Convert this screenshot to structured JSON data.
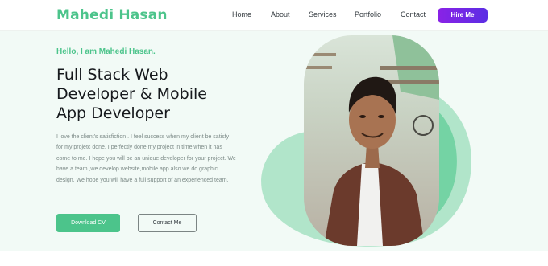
{
  "brand": {
    "name": "Mahedi Hasan"
  },
  "nav": {
    "items": [
      {
        "label": "Home"
      },
      {
        "label": "About"
      },
      {
        "label": "Services"
      },
      {
        "label": "Portfolio"
      },
      {
        "label": "Contact"
      }
    ],
    "cta_label": "Hire Me"
  },
  "hero": {
    "greeting": "Hello, I am Mahedi Hasan.",
    "headline_lines": [
      "Full Stack Web",
      "Developer & Mobile",
      "App Developer"
    ],
    "description": "I love the client's satisfiction . I feel success when my client be satisfy for my projetc done. I perfectly done my project in time when it has come to me. I hope you will be an unique developer for your project. We have a team ,we develop website,mobile app also we do graphic design. We hope you will have a full support of an experienced team.",
    "download_label": "Download CV",
    "contact_label": "Contact Me"
  },
  "colors": {
    "accent": "#4cc48b",
    "hire_gradient": [
      "#8a22e6",
      "#5b2de4"
    ],
    "hero_bg": "#f2faf6"
  }
}
